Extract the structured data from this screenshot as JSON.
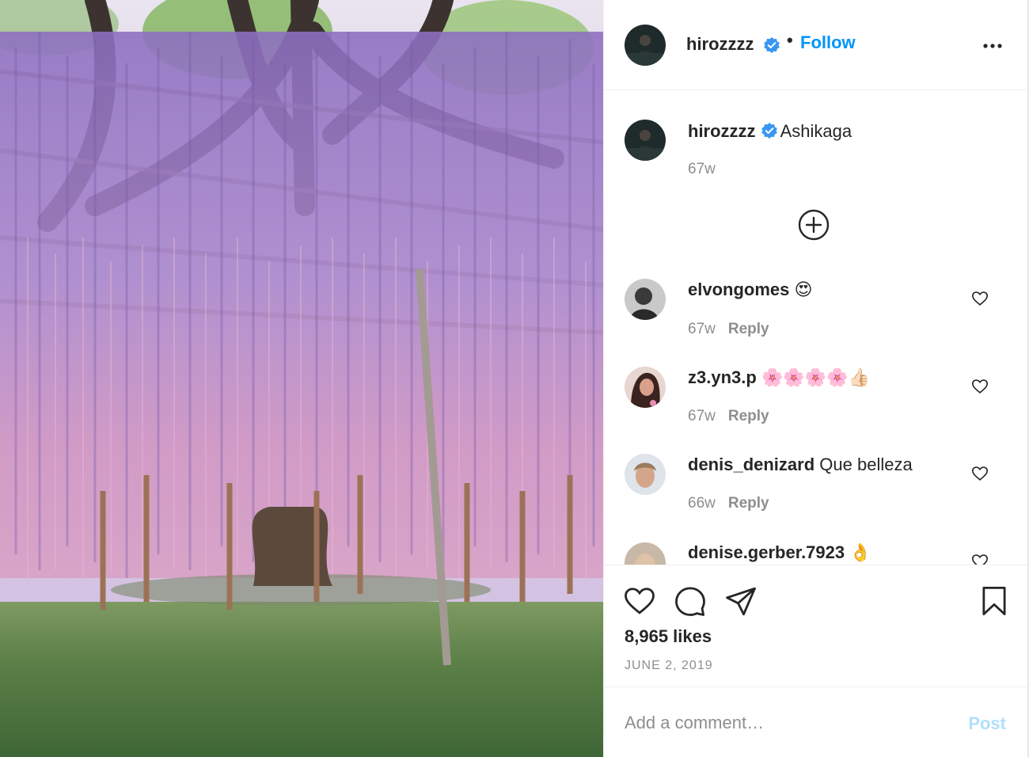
{
  "post": {
    "author": "hirozzzz",
    "author_verified": true,
    "separator": "•",
    "follow_label": "Follow",
    "more_icon": "more-horizontal-icon",
    "caption": {
      "user": "hirozzzz",
      "text": "Ashikaga",
      "time": "67w"
    },
    "load_more_icon": "plus-circle-icon",
    "comments": [
      {
        "user": "elvongomes",
        "text": "😍",
        "time": "67w",
        "reply": "Reply"
      },
      {
        "user": "z3.yn3.p",
        "text": "🌸🌸🌸🌸👍🏻",
        "time": "67w",
        "reply": "Reply"
      },
      {
        "user": "denis_denizard",
        "text": "Que belleza",
        "time": "66w",
        "reply": "Reply"
      },
      {
        "user": "denise.gerber.7923",
        "text": "👌"
      }
    ],
    "likes": "8,965 likes",
    "date": "JUNE 2, 2019",
    "add_comment_placeholder": "Add a comment…",
    "post_label": "Post",
    "icons": [
      "heart-icon",
      "comment-icon",
      "share-icon",
      "bookmark-icon"
    ]
  },
  "colors": {
    "link_blue": "#0095f6",
    "post_disabled": "#b2dffc",
    "muted": "#8e8e8e",
    "text": "#262626",
    "verified": "#3897f0"
  }
}
